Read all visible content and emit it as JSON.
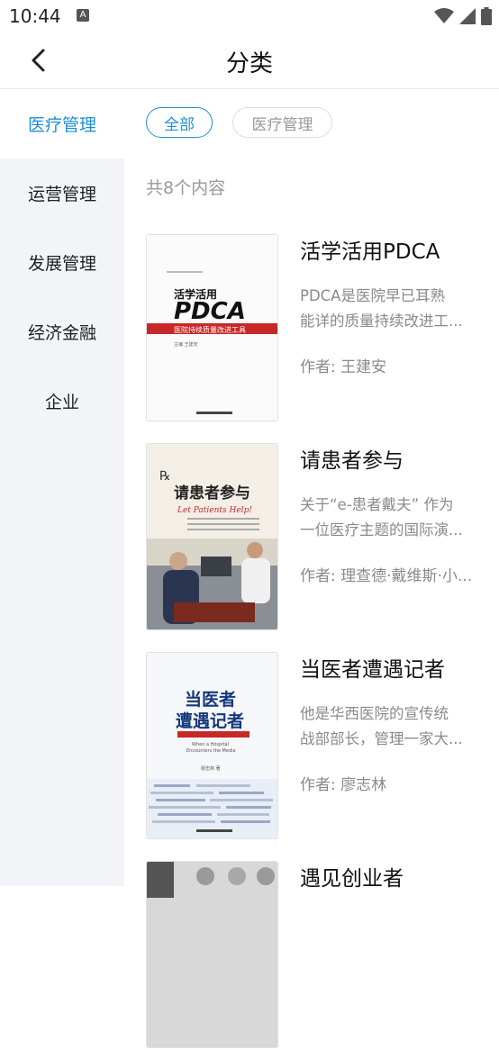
{
  "status": {
    "time": "10:44",
    "notif_badge": "A"
  },
  "nav": {
    "title": "分类"
  },
  "sidebar": {
    "items": [
      {
        "label": "医疗管理",
        "active": true
      },
      {
        "label": "运营管理"
      },
      {
        "label": "发展管理"
      },
      {
        "label": "经济金融"
      },
      {
        "label": "企业"
      }
    ]
  },
  "filters": {
    "all": "全部",
    "category": "医疗管理"
  },
  "content_count": "共8个内容",
  "books": [
    {
      "title": "活学活用PDCA",
      "desc_lines": [
        "PDCA是医院早已耳熟",
        "能详的质量持续改进工..."
      ],
      "author": "作者: 王建安",
      "cover": {
        "small_title": "活学活用",
        "big_title": "PDCA",
        "subtitle": "医院持续质量改进工具",
        "editor": "主编 王建安"
      }
    },
    {
      "title": "请患者参与",
      "desc_lines": [
        "关于“e-患者戴夫” 作为",
        "一位医疗主题的国际演..."
      ],
      "author": "作者: 理查德·戴维斯·小...",
      "cover": {
        "rx": "℞",
        "cn_title": "请患者参与",
        "en_title": "Let Patients Help!"
      }
    },
    {
      "title": "当医者遭遇记者",
      "desc_lines": [
        "他是华西医院的宣传统",
        "战部部长，管理一家大..."
      ],
      "author": "作者: 廖志林",
      "cover": {
        "cn_title_1": "当医者",
        "cn_title_2": "遭遇记者",
        "en_title_1": "When a Hospital",
        "en_title_2": "Encounters the Media",
        "author": "廖志林 著"
      }
    },
    {
      "title": "遇见创业者",
      "desc_lines": [],
      "author": ""
    }
  ],
  "colors": {
    "accent": "#1e8fd6",
    "sidebar_bg": "#f3f4f8",
    "muted": "#8a8a8a"
  }
}
